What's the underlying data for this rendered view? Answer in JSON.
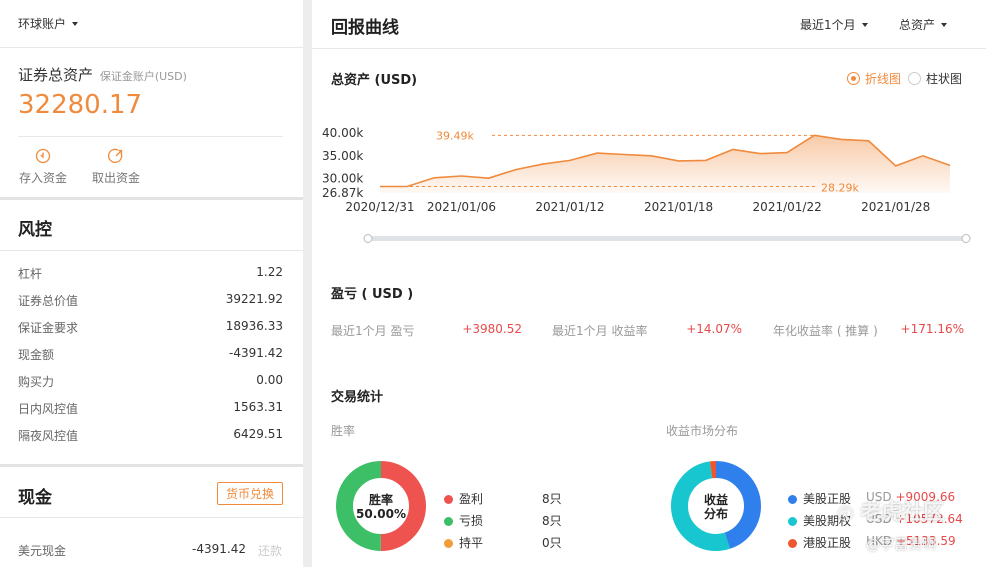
{
  "left": {
    "account_selector": "环球账户",
    "assets": {
      "title": "证券总资产",
      "subtitle": "保证金账户(USD)",
      "value": "32280.17"
    },
    "actions": [
      {
        "label": "存入资金",
        "icon": "deposit-icon"
      },
      {
        "label": "取出资金",
        "icon": "withdraw-icon"
      }
    ],
    "risk": {
      "title": "风控",
      "rows": [
        {
          "label": "杠杆",
          "value": "1.22"
        },
        {
          "label": "证券总价值",
          "value": "39221.92"
        },
        {
          "label": "保证金要求",
          "value": "18936.33"
        },
        {
          "label": "现金额",
          "value": "-4391.42"
        },
        {
          "label": "购买力",
          "value": "0.00"
        },
        {
          "label": "日内风控值",
          "value": "1563.31"
        },
        {
          "label": "隔夜风控值",
          "value": "6429.51"
        }
      ]
    },
    "cash": {
      "title": "现金",
      "exchange_button": "货币兑换",
      "rows": [
        {
          "label": "美元现金",
          "value": "-4391.42",
          "action": "还款"
        }
      ]
    }
  },
  "right": {
    "title": "回报曲线",
    "period_selector": "最近1个月",
    "metric_selector": "总资产",
    "chart_section": {
      "title": "总资产 (USD)",
      "toggle": [
        {
          "label": "折线图",
          "selected": true
        },
        {
          "label": "柱状图",
          "selected": false
        }
      ]
    },
    "pnl": {
      "title": "盈亏 ( USD )",
      "items": [
        {
          "label": "最近1个月 盈亏",
          "value": "+3980.52"
        },
        {
          "label": "最近1个月 收益率",
          "value": "+14.07%"
        },
        {
          "label": "年化收益率 ( 推算 )",
          "value": "+171.16%"
        }
      ]
    },
    "trade_stats": {
      "title": "交易统计",
      "winrate": {
        "label": "胜率",
        "center_line1": "胜率",
        "center_line2": "50.00%",
        "legend": [
          {
            "label": "盈利",
            "value": "8只",
            "color": "#ef5350"
          },
          {
            "label": "亏损",
            "value": "8只",
            "color": "#3dbf68"
          },
          {
            "label": "持平",
            "value": "0只",
            "color": "#f39c3c"
          }
        ]
      },
      "market": {
        "label": "收益市场分布",
        "center_line1": "收益",
        "center_line2": "分布",
        "legend": [
          {
            "label": "美股正股",
            "currency": "USD",
            "value": "+9009.66",
            "color": "#2f80ed"
          },
          {
            "label": "美股期权",
            "currency": "USD",
            "value": "+10572.64",
            "color": "#18c6cf"
          },
          {
            "label": "港股正股",
            "currency": "HKD",
            "value": "+5133.59",
            "color": "#f0562e"
          }
        ]
      }
    },
    "watermark": {
      "line1": "老虎社区",
      "line2": "@学富贵啊"
    }
  },
  "chart_data": {
    "type": "area",
    "title": "总资产 (USD)",
    "xlabel": "",
    "ylabel": "",
    "x_ticks": [
      "2020/12/31",
      "2021/01/06",
      "2021/01/12",
      "2021/01/18",
      "2021/01/22",
      "2021/01/28"
    ],
    "y_ticks": [
      "40.00k",
      "35.00k",
      "30.00k",
      "26.87k"
    ],
    "ylim": [
      26.87,
      40.0
    ],
    "max_label": "39.49k",
    "min_label": "28.29k",
    "line_color": "#f08a3c",
    "series": [
      {
        "x": [
          "2020/12/31",
          "2021/01/04",
          "2021/01/05",
          "2021/01/06",
          "2021/01/07",
          "2021/01/08",
          "2021/01/11",
          "2021/01/12",
          "2021/01/13",
          "2021/01/14",
          "2021/01/15",
          "2021/01/18",
          "2021/01/19",
          "2021/01/20",
          "2021/01/21",
          "2021/01/22",
          "2021/01/25",
          "2021/01/26",
          "2021/01/27",
          "2021/01/28",
          "2021/01/29",
          "2021/01/30"
        ],
        "values": [
          28.29,
          28.29,
          30.2,
          30.6,
          30.1,
          32.0,
          33.2,
          34.0,
          35.6,
          35.3,
          35.0,
          33.9,
          34.0,
          36.4,
          35.5,
          35.7,
          39.49,
          38.6,
          38.3,
          32.8,
          35.0,
          32.9
        ]
      }
    ]
  }
}
